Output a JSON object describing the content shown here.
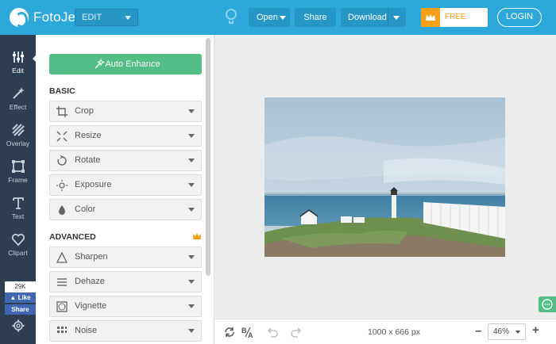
{
  "app": {
    "name": "FotoJet",
    "mode_select": "EDIT"
  },
  "toolbar": {
    "open_label": "Open",
    "share_label": "Share",
    "download_label": "Download",
    "free_trial_label": "FREE TRIAL",
    "login_label": "LOGIN"
  },
  "nav": {
    "items": [
      {
        "label": "Edit",
        "icon": "sliders-icon"
      },
      {
        "label": "Effect",
        "icon": "magic-wand-icon"
      },
      {
        "label": "Overlay",
        "icon": "stripes-icon"
      },
      {
        "label": "Frame",
        "icon": "frame-icon"
      },
      {
        "label": "Text",
        "icon": "text-icon"
      },
      {
        "label": "Clipart",
        "icon": "heart-icon"
      }
    ],
    "social": {
      "count": "29K",
      "like_label": "Like",
      "share_label": "Share"
    }
  },
  "panel": {
    "auto_enhance_label": "Auto Enhance",
    "basic_title": "BASIC",
    "basic_tools": [
      "Crop",
      "Resize",
      "Rotate",
      "Exposure",
      "Color"
    ],
    "advanced_title": "ADVANCED",
    "advanced_tools": [
      "Sharpen",
      "Dehaze",
      "Vignette",
      "Noise"
    ]
  },
  "status": {
    "dimensions": "1000 x 666 px",
    "zoom": "46%"
  },
  "colors": {
    "brand_blue": "#2ca8db",
    "nav_dark": "#2d3e50",
    "accent_green": "#52bd85",
    "trial_orange": "#f7a11a"
  }
}
